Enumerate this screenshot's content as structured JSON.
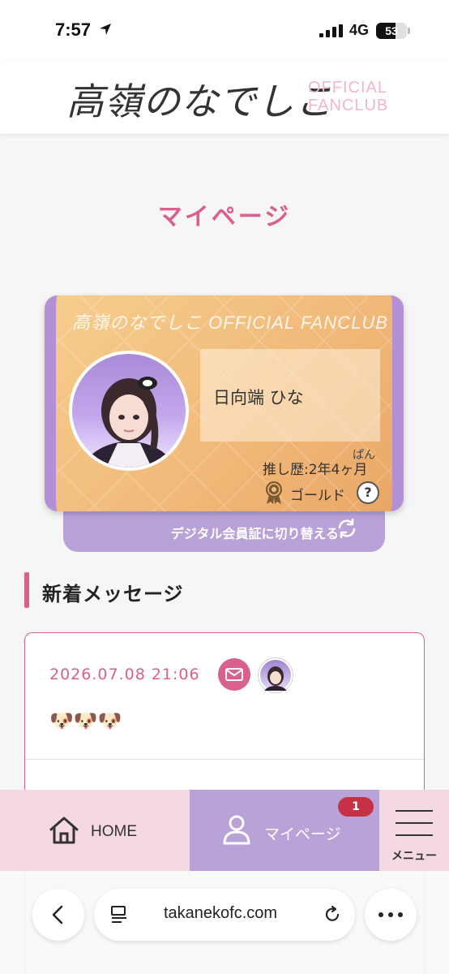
{
  "status_bar": {
    "time": "7:57",
    "network": "4G",
    "battery": "53"
  },
  "header": {
    "logo_main": "高嶺のなでしこ",
    "logo_sub_line1": "OFFICIAL",
    "logo_sub_line2": "FANCLUB"
  },
  "page": {
    "title": "マイページ"
  },
  "member_card": {
    "card_title": "高嶺のなでしこ OFFICIAL FANCLUB",
    "member_name": "日向端 ひな",
    "history_ruby": "ぱん",
    "history": "推し歴:2年4ヶ月",
    "rank": "ゴールド",
    "help": "?",
    "switch_label": "デジタル会員証に切り替える",
    "colors": {
      "card": "#f2be7e",
      "frame": "#b38fd6",
      "switch": "#b9a2d8"
    }
  },
  "messages": {
    "section_title": "新着メッセージ",
    "items": [
      {
        "date": "2026.07.08 21:06",
        "body": "🐶🐶🐶"
      }
    ]
  },
  "tab_bar": {
    "home": "HOME",
    "mypage": "マイページ",
    "mypage_badge": "1",
    "menu": "メニュー"
  },
  "browser": {
    "url": "takanekofc.com"
  },
  "theme": {
    "accent": "#d9608f",
    "purple": "#b9a2d8",
    "pink_bg": "#f4d9e2"
  }
}
